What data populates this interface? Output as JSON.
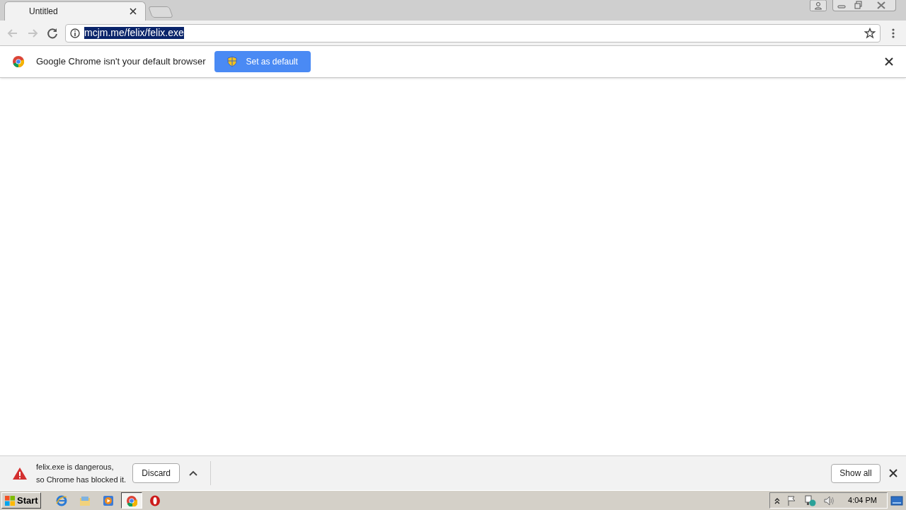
{
  "tabs": [
    {
      "title": "Untitled",
      "selected": true
    }
  ],
  "address": {
    "text": "mcjm.me/felix/felix.exe",
    "selected": true
  },
  "infobar": {
    "message": "Google Chrome isn't your default browser",
    "button": "Set as default"
  },
  "download_bar": {
    "message_lines": [
      "felix.exe is dangerous,",
      "so Chrome has blocked it."
    ],
    "discard": "Discard",
    "show_all": "Show all"
  },
  "taskbar": {
    "start": "Start",
    "items": [
      {
        "kind": "ie",
        "selected": false
      },
      {
        "kind": "folder",
        "selected": false
      },
      {
        "kind": "media",
        "selected": false
      },
      {
        "kind": "chrome",
        "selected": true
      },
      {
        "kind": "opera",
        "selected": false
      }
    ],
    "clock": "4:04 PM"
  }
}
